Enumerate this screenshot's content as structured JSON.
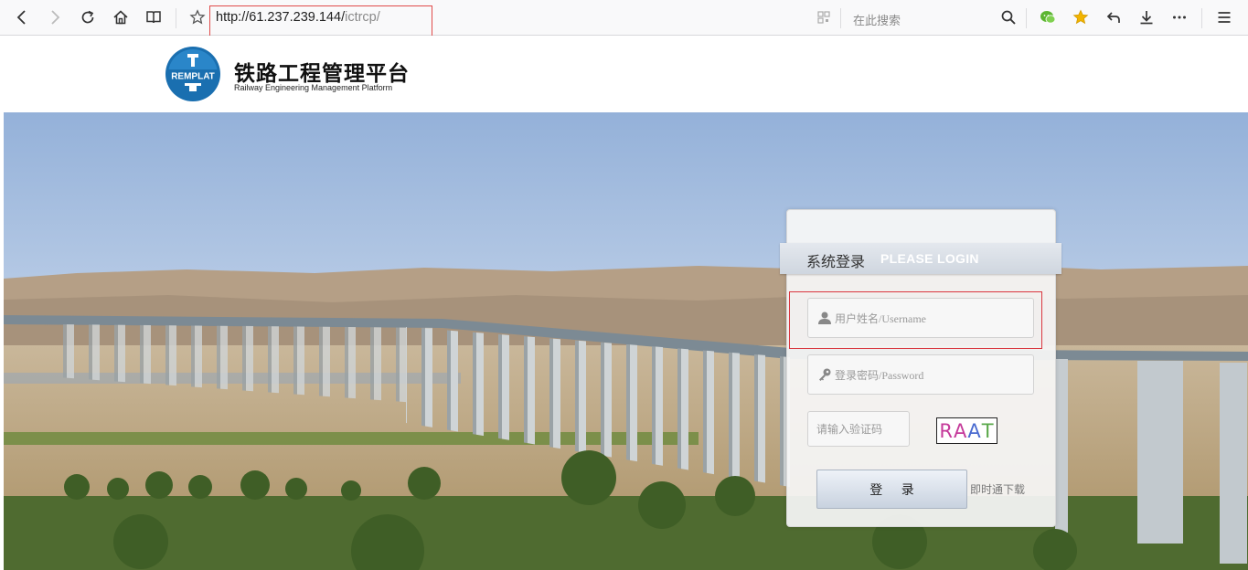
{
  "browser": {
    "url_host": "http://61.237.239.144/",
    "url_path": "ictrcp/",
    "search_placeholder": "在此搜索",
    "icons": [
      "back-icon",
      "forward-icon",
      "reload-icon",
      "home-icon",
      "reader-icon",
      "bookmark-star-icon",
      "qr-code-icon",
      "search-icon",
      "wechat-icon",
      "favorite-star-icon",
      "undo-icon",
      "download-icon",
      "more-icon",
      "menu-icon"
    ],
    "colors": {
      "highlight": "#e04a4a",
      "favorite": "#f2b400",
      "wechat": "#5cb531"
    }
  },
  "site": {
    "logo_text": "REMPLAT",
    "title_cn": "铁路工程管理平台",
    "title_en": "Railway Engineering Management Platform",
    "brand_color": "#1a6fb0"
  },
  "login": {
    "title": "系统登录",
    "subtitle": "PLEASE LOGIN",
    "username_placeholder": "用户姓名/Username",
    "password_placeholder": "登录密码/Password",
    "captcha_placeholder": "请输入验证码",
    "captcha_text": [
      "R",
      "A",
      "A",
      "T"
    ],
    "captcha_colors": [
      "#c53a9a",
      "#c53a9a",
      "#4a6bd0",
      "#5aa84a"
    ],
    "login_button": "登 录",
    "download_link": "即时通下载"
  }
}
